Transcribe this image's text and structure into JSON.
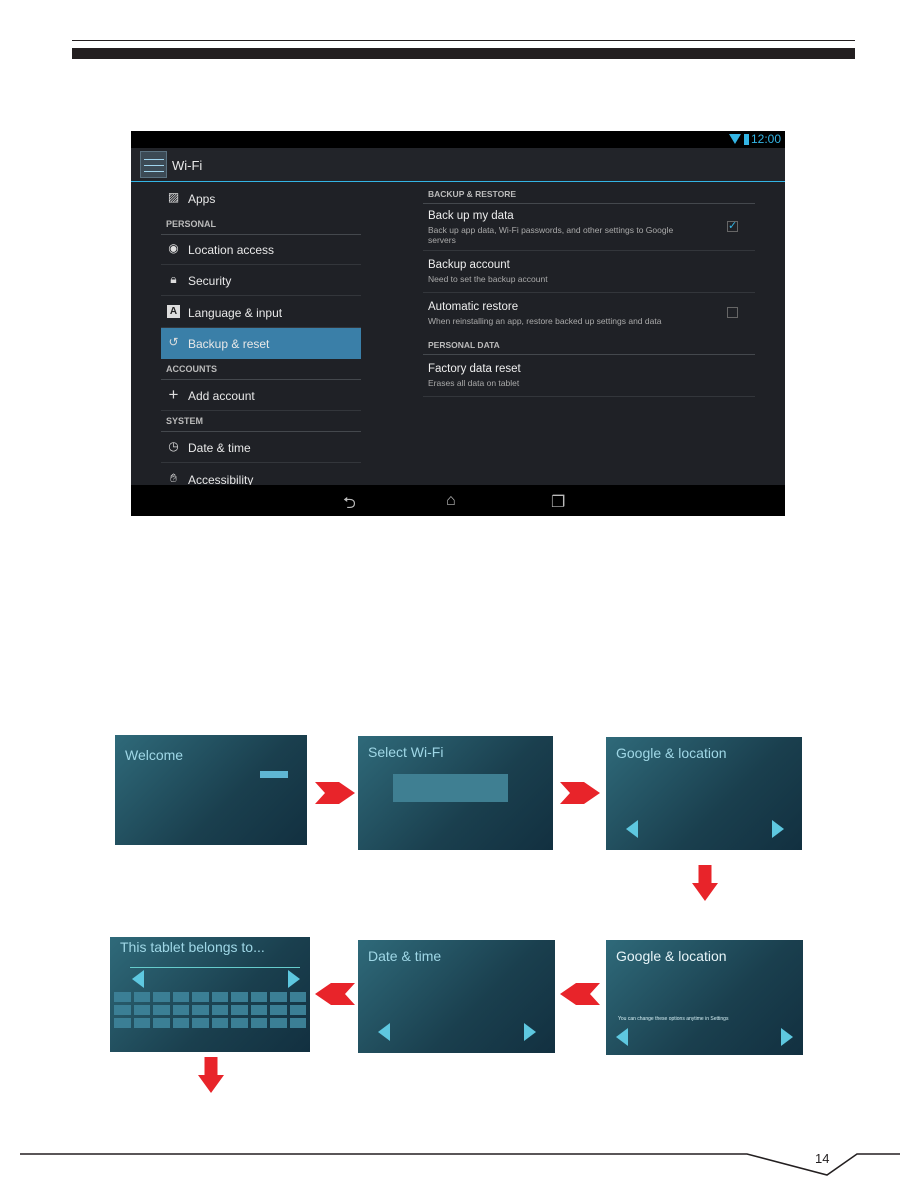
{
  "settings": {
    "status_time": "12:00",
    "action_title": "Wi-Fi",
    "left": [
      {
        "type": "item",
        "label": "Apps",
        "icon": "apps-icon"
      },
      {
        "type": "header",
        "label": "PERSONAL"
      },
      {
        "type": "item",
        "label": "Location access",
        "icon": "location-icon"
      },
      {
        "type": "item",
        "label": "Security",
        "icon": "lock-icon"
      },
      {
        "type": "item",
        "label": "Language & input",
        "icon": "language-icon"
      },
      {
        "type": "item",
        "label": "Backup & reset",
        "icon": "backup-icon",
        "selected": true
      },
      {
        "type": "header",
        "label": "ACCOUNTS"
      },
      {
        "type": "item",
        "label": "Add account",
        "icon": "plus-icon"
      },
      {
        "type": "header",
        "label": "SYSTEM"
      },
      {
        "type": "item",
        "label": "Date & time",
        "icon": "clock-icon"
      },
      {
        "type": "item",
        "label": "Accessibility",
        "icon": "hand-icon"
      }
    ],
    "right": {
      "backup_header": "BACKUP & RESTORE",
      "backup_my_data": {
        "title": "Back up my data",
        "summary": "Back up app data, Wi-Fi passwords, and other settings to Google servers",
        "checked": true
      },
      "backup_account": {
        "title": "Backup account",
        "summary": "Need to set the backup account"
      },
      "auto_restore": {
        "title": "Automatic restore",
        "summary": "When reinstalling an app, restore backed up settings and data",
        "checked": false
      },
      "personal_header": "PERSONAL DATA",
      "factory_reset": {
        "title": "Factory data reset",
        "summary": "Erases all data on tablet"
      }
    },
    "accent": "#33b5e5"
  },
  "setup_steps": [
    {
      "title": "Welcome"
    },
    {
      "title": "Select Wi-Fi"
    },
    {
      "title": "Google & location"
    },
    {
      "title": "Google & location",
      "note": "You can change these options anytime in Settings"
    },
    {
      "title": "Date & time"
    },
    {
      "title": "This tablet belongs to..."
    }
  ],
  "arrow_color": "#e8242a",
  "page_number": "14"
}
